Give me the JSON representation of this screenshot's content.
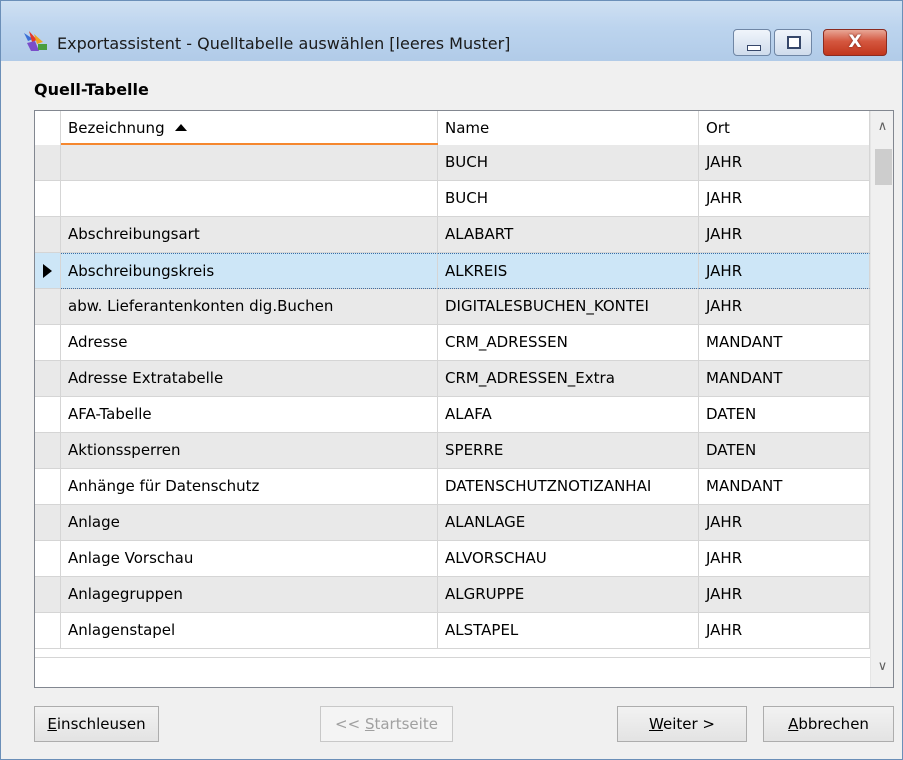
{
  "window": {
    "title": "Exportassistent - Quelltabelle auswählen [leeres Muster]",
    "icon": "export-wizard-icon",
    "controls": {
      "minimize": "minimize-icon",
      "maximize": "maximize-icon",
      "close_glyph": "X"
    }
  },
  "group": {
    "title": "Quell-Tabelle"
  },
  "table": {
    "columns": [
      "Bezeichnung",
      "Name",
      "Ort"
    ],
    "sorted_column": "Bezeichnung",
    "sort_direction": "ascending",
    "rows": [
      {
        "bezeichnung": "",
        "name": "BUCH",
        "ort": "JAHR",
        "selected": false
      },
      {
        "bezeichnung": "",
        "name": "BUCH",
        "ort": "JAHR",
        "selected": false
      },
      {
        "bezeichnung": "Abschreibungsart",
        "name": "ALABART",
        "ort": "JAHR",
        "selected": false
      },
      {
        "bezeichnung": "Abschreibungskreis",
        "name": "ALKREIS",
        "ort": "JAHR",
        "selected": true
      },
      {
        "bezeichnung": "abw. Lieferantenkonten dig.Buchen",
        "name": "DIGITALESBUCHEN_KONTEI",
        "ort": "JAHR",
        "selected": false
      },
      {
        "bezeichnung": "Adresse",
        "name": "CRM_ADRESSEN",
        "ort": "MANDANT",
        "selected": false
      },
      {
        "bezeichnung": "Adresse Extratabelle",
        "name": "CRM_ADRESSEN_Extra",
        "ort": "MANDANT",
        "selected": false
      },
      {
        "bezeichnung": "AFA-Tabelle",
        "name": "ALAFA",
        "ort": "DATEN",
        "selected": false
      },
      {
        "bezeichnung": "Aktionssperren",
        "name": "SPERRE",
        "ort": "DATEN",
        "selected": false
      },
      {
        "bezeichnung": "Anhänge für Datenschutz",
        "name": "DATENSCHUTZNOTIZANHAI",
        "ort": "MANDANT",
        "selected": false
      },
      {
        "bezeichnung": "Anlage",
        "name": "ALANLAGE",
        "ort": "JAHR",
        "selected": false
      },
      {
        "bezeichnung": "Anlage Vorschau",
        "name": "ALVORSCHAU",
        "ort": "JAHR",
        "selected": false
      },
      {
        "bezeichnung": "Anlagegruppen",
        "name": "ALGRUPPE",
        "ort": "JAHR",
        "selected": false
      },
      {
        "bezeichnung": "Anlagenstapel",
        "name": "ALSTAPEL",
        "ort": "JAHR",
        "selected": false
      }
    ]
  },
  "buttons": {
    "einschleusen": {
      "mnemonic": "E",
      "rest": "inschleusen"
    },
    "startseite": {
      "prefix": "<< ",
      "mnemonic": "S",
      "rest": "tartseite",
      "enabled": false
    },
    "weiter": {
      "mnemonic": "W",
      "rest": "eiter >"
    },
    "abbrechen": {
      "mnemonic": "A",
      "rest": "bbrechen"
    }
  },
  "colors": {
    "selection": "#cde6f7",
    "alt_row": "#e9e9e9",
    "sort_indicator": "#f5872e"
  }
}
